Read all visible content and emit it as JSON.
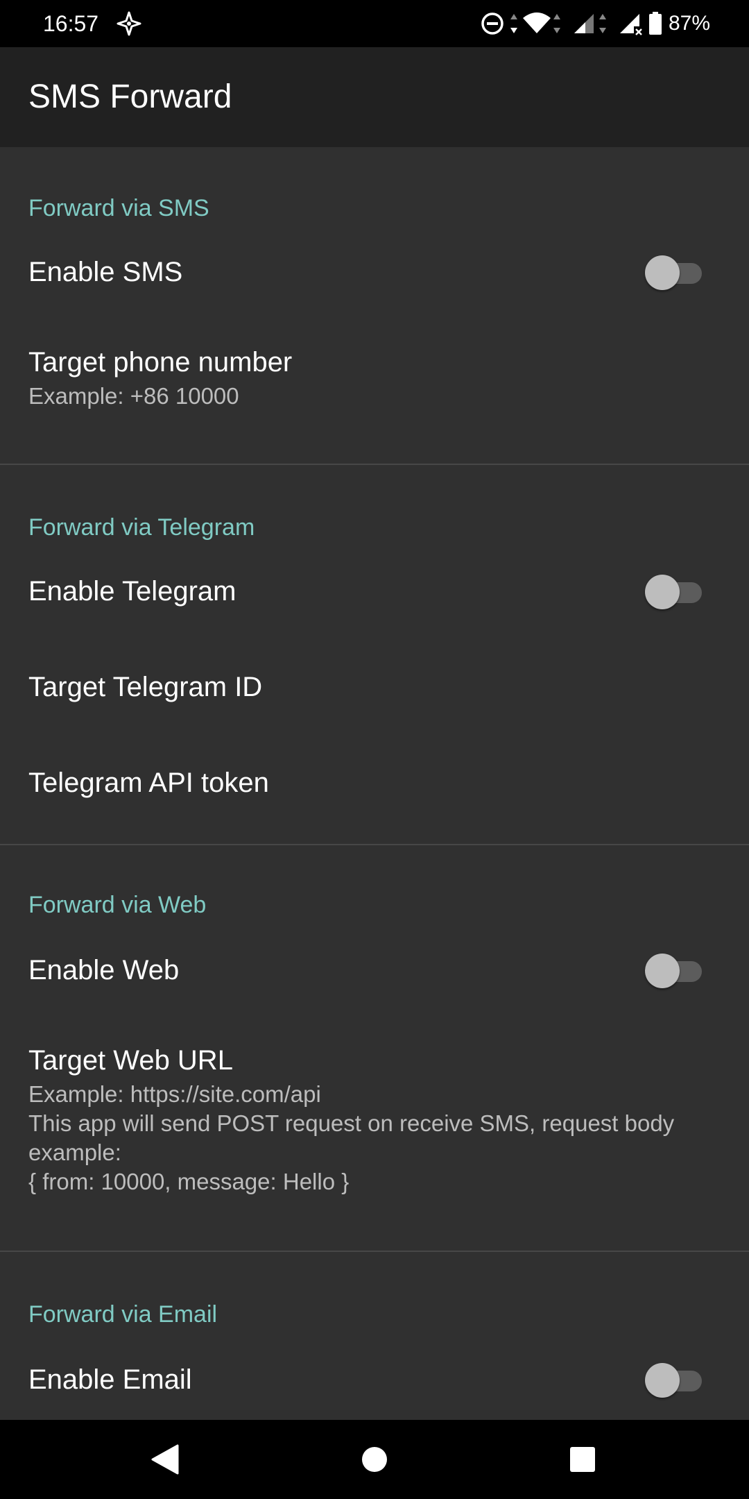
{
  "status_bar": {
    "time": "16:57",
    "battery_percent": "87%",
    "icons": [
      "location-icon",
      "do-not-disturb-icon",
      "wifi-icon",
      "signal-icon",
      "signal-no-sim-icon",
      "battery-icon"
    ]
  },
  "app": {
    "title": "SMS Forward"
  },
  "categories": [
    {
      "title": "Forward via SMS",
      "prefs": [
        {
          "title": "Enable SMS",
          "type": "switch",
          "checked": false
        },
        {
          "title": "Target phone number",
          "summary": "Example: +86 10000"
        }
      ]
    },
    {
      "title": "Forward via Telegram",
      "prefs": [
        {
          "title": "Enable Telegram",
          "type": "switch",
          "checked": false
        },
        {
          "title": "Target Telegram ID"
        },
        {
          "title": "Telegram API token"
        }
      ]
    },
    {
      "title": "Forward via Web",
      "prefs": [
        {
          "title": "Enable Web",
          "type": "switch",
          "checked": false
        },
        {
          "title": "Target Web URL",
          "summary": "Example: https://site.com/api\nThis app will send POST request on receive SMS, request body example:\n{ from: 10000, message: Hello }"
        }
      ]
    },
    {
      "title": "Forward via Email",
      "prefs": [
        {
          "title": "Enable Email",
          "type": "switch",
          "checked": false
        }
      ]
    }
  ],
  "nav_bar": {
    "buttons": [
      "back-icon",
      "home-icon",
      "recents-icon"
    ]
  },
  "colors": {
    "accent": "#80cbc4",
    "background": "#303030",
    "toolbar": "#212121",
    "divider": "#474747"
  }
}
